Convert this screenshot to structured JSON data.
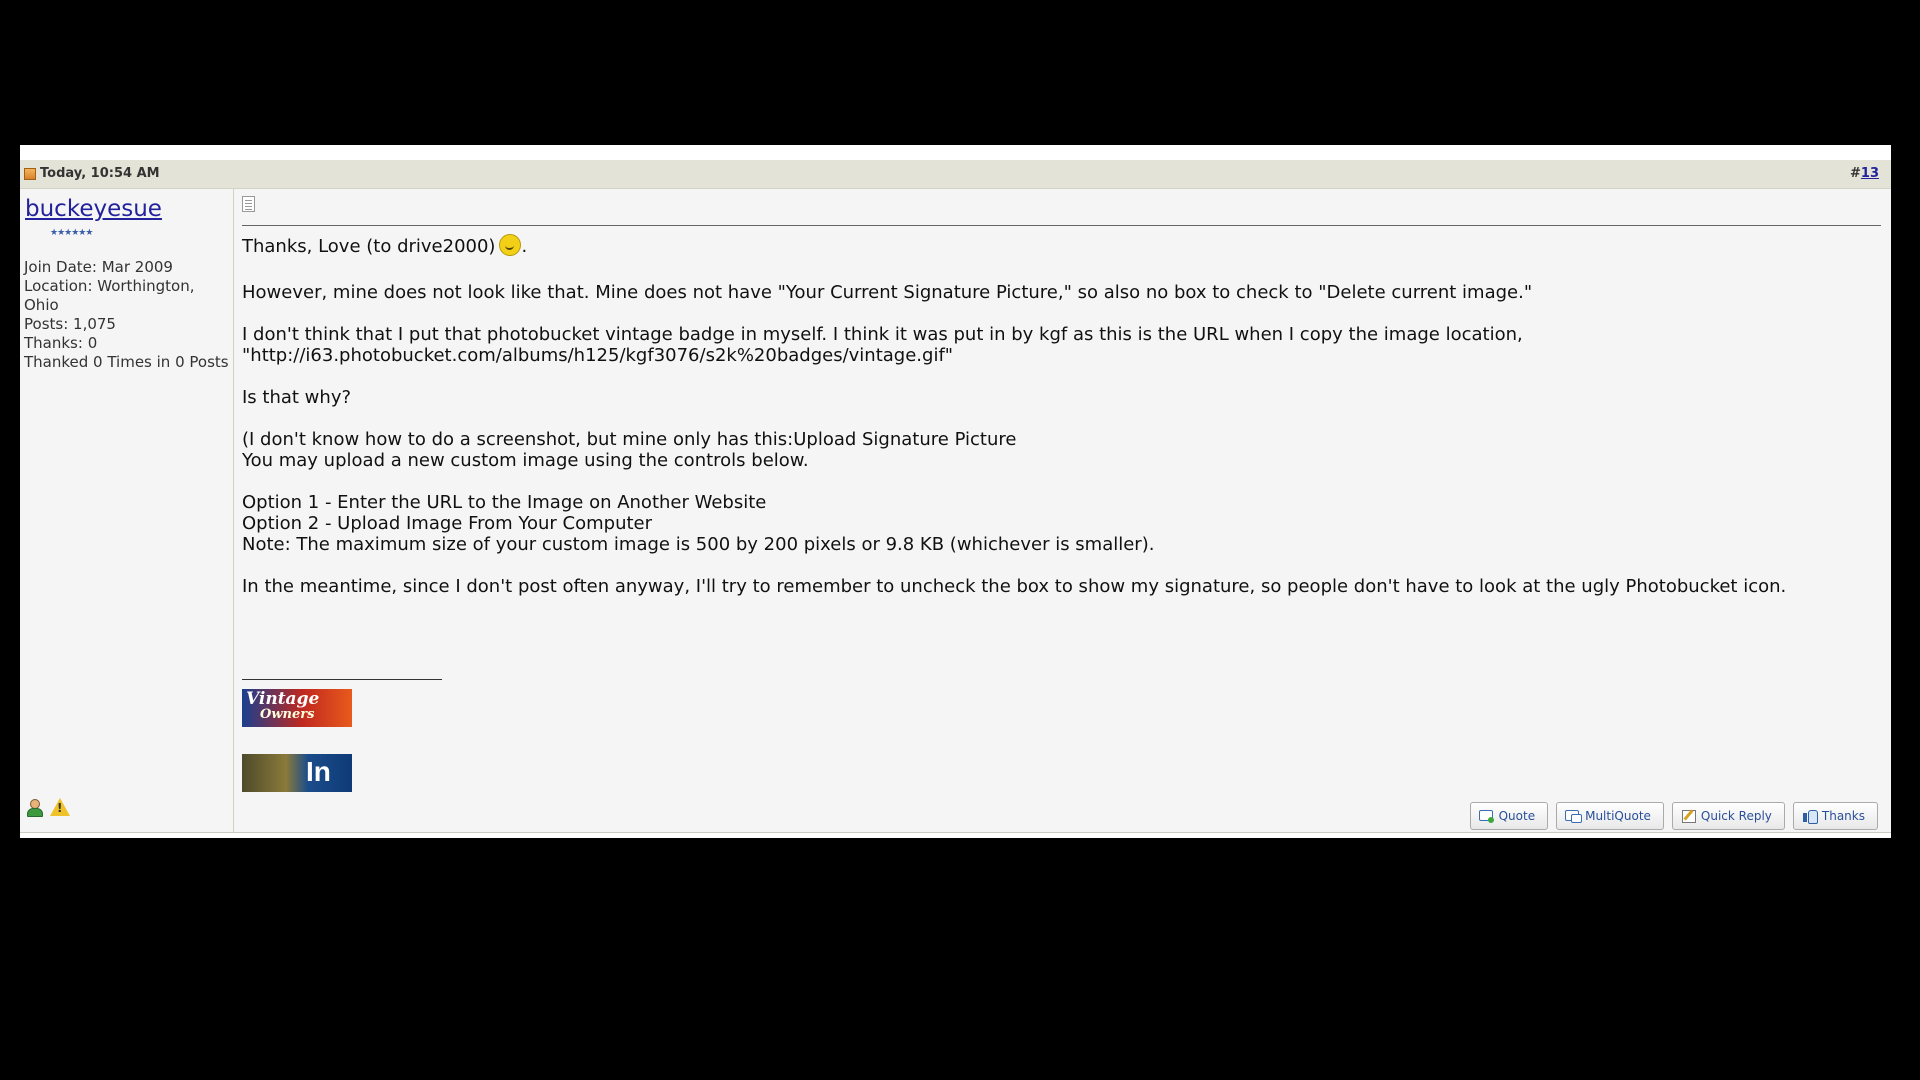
{
  "post": {
    "date": "Today, 10:54 AM",
    "number_prefix": "#",
    "number": "13"
  },
  "user": {
    "name": "buckeyesue",
    "rank_stars": "★★★★★★",
    "stats": [
      "Join Date: Mar 2009",
      "Location: Worthington, Ohio",
      "Posts: 1,075",
      "Thanks: 0",
      "Thanked 0 Times in 0 Posts"
    ]
  },
  "message": {
    "line1_prefix": "Thanks, Love (to drive2000)",
    "line1_suffix": ".",
    "p2": "However, mine does not look like that. Mine does not have \"Your Current Signature Picture,\" so also no box to check to \"Delete current image.\"",
    "p3a": "I don't think that I put that photobucket vintage badge in myself. I think it was put in by kgf as this is the URL when I copy the image location,",
    "p3b": "\"http://i63.photobucket.com/albums/h125/kgf3076/s2k%20badges/vintage.gif\"",
    "p4": "Is that why?",
    "p5a": "(I don't know how to do a screenshot, but mine only has this:Upload Signature Picture",
    "p5b": "You may upload a new custom image using the controls below.",
    "p6a": "Option 1 - Enter the URL to the Image on Another Website",
    "p6b": "Option 2 - Upload Image From Your Computer",
    "p6c": "Note: The maximum size of your custom image is 500 by 200 pixels or 9.8 KB (whichever is smaller).",
    "p7": "In the meantime, since I don't post often anyway, I'll try to remember to uncheck the box to show my signature, so people don't have to look at the ugly Photobucket icon."
  },
  "signature": {
    "vintage_text": "Vintage",
    "vintage_sub": "Owners",
    "inm_text": "In M"
  },
  "buttons": {
    "quote": "Quote",
    "multiquote": "MultiQuote",
    "quick_reply": "Quick Reply",
    "thanks": "Thanks"
  },
  "colors": {
    "link": "#22229c",
    "header_bg": "#e3e4d7",
    "post_bg": "#f5f5f5"
  }
}
